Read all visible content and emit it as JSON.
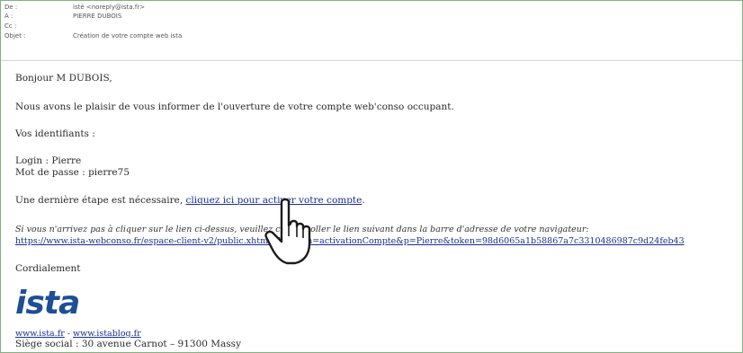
{
  "header": {
    "from_label": "De :",
    "from_value": "istè <noreply@ista.fr>",
    "to_label": "À :",
    "to_value": "PIERRE DUBOIS",
    "cc_label": "Cc :",
    "cc_value": "",
    "subject_label": "Objet :",
    "subject_value": "Création de votre compte web ista"
  },
  "email": {
    "greeting": "Bonjour M DUBOIS,",
    "intro": "Nous avons le plaisir de vous informer de l'ouverture de votre compte web'conso occupant.",
    "ids_title": "Vos identifiants :",
    "login": "Login : Pierre",
    "password": "Mot de passe : pierre75",
    "step_text": "Une dernière étape est nécessaire, ",
    "activate_link": "cliquez ici pour activer votre compte",
    "step_suffix": ".",
    "fallback_text": "Si vous n'arrivez pas à cliquer sur le lien ci-dessus, veuillez copier-coller le lien suivant dans la barre d'adresse de votre navigateur:",
    "fallback_url": "https://www.ista-webconso.fr/espace-client-v2/public.xhtml?dispatch=activationCompte&p=Pierre&token=98d6065a1b58867a7c3310486987c9d24feb43",
    "closing": "Cordialement",
    "logo_text": "ista",
    "site_link_1": "www.ista.fr",
    "site_sep": " - ",
    "site_link_2": "www.istablog.fr",
    "address": "Siège social : 30 avenue Carnot – 91300 Massy"
  },
  "colors": {
    "link": "#1a2e8f",
    "logo": "#1d4f96",
    "frame": "#7fb27f"
  },
  "icons": {
    "cursor": "hand-pointer-icon"
  }
}
